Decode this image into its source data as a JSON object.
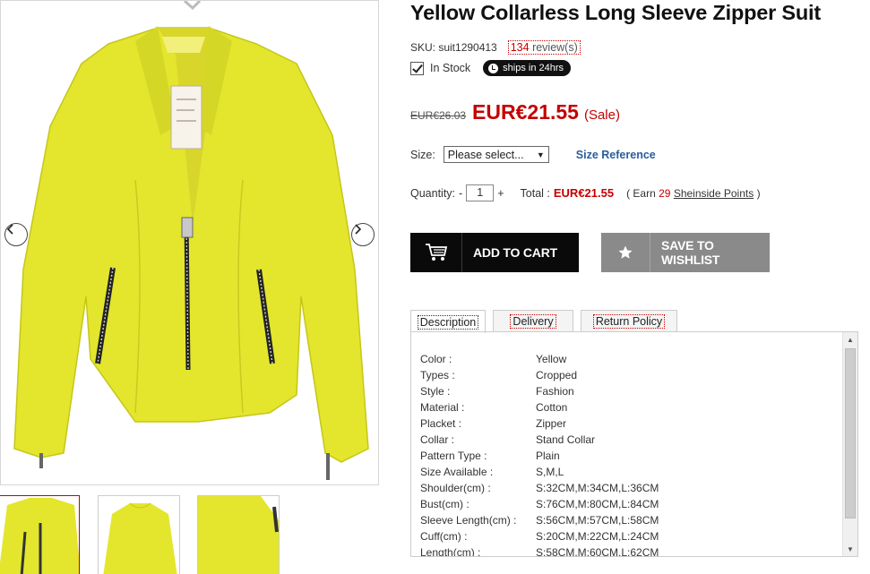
{
  "product": {
    "title": "Yellow Collarless Long Sleeve Zipper Suit",
    "sku_label": "SKU: suit1290413",
    "review_count": "134",
    "review_suffix": " review(s)",
    "stock_text": "In Stock",
    "ships_badge": "ships in 24hrs",
    "old_price": "EUR€26.03",
    "price": "EUR€21.55",
    "sale_tag": "(Sale)",
    "jacket_color": "#e3e62c"
  },
  "size": {
    "label": "Size:",
    "placeholder": "Please select...",
    "reference_link": "Size Reference"
  },
  "quantity": {
    "label": "Quantity:",
    "minus": "-",
    "value": "1",
    "plus": "+",
    "total_label": "Total :",
    "total_value": "EUR€21.55",
    "earn_prefix": "( Earn",
    "earn_points": "29",
    "earn_link": "Sheinside Points",
    "earn_suffix": ")"
  },
  "buttons": {
    "add_to_cart": "ADD TO CART",
    "wishlist": "SAVE TO WISHLIST"
  },
  "tabs": [
    {
      "label": "Description"
    },
    {
      "label": "Delivery"
    },
    {
      "label": "Return Policy"
    }
  ],
  "specs": [
    {
      "key": "Color :",
      "value": "Yellow"
    },
    {
      "key": "Types :",
      "value": "Cropped"
    },
    {
      "key": "Style :",
      "value": "Fashion"
    },
    {
      "key": "Material :",
      "value": "Cotton"
    },
    {
      "key": "Placket :",
      "value": "Zipper"
    },
    {
      "key": "Collar :",
      "value": "Stand Collar"
    },
    {
      "key": "Pattern Type :",
      "value": "Plain"
    },
    {
      "key": "Size Available :",
      "value": "S,M,L"
    },
    {
      "key": "Shoulder(cm) :",
      "value": "S:32CM,M:34CM,L:36CM"
    },
    {
      "key": "Bust(cm) :",
      "value": "S:76CM,M:80CM,L:84CM"
    },
    {
      "key": "Sleeve Length(cm) :",
      "value": "S:56CM,M:57CM,L:58CM"
    },
    {
      "key": "Cuff(cm) :",
      "value": "S:20CM,M:22CM,L:24CM"
    },
    {
      "key": "Length(cm) :",
      "value": "S:58CM,M:60CM,L:62CM"
    }
  ]
}
